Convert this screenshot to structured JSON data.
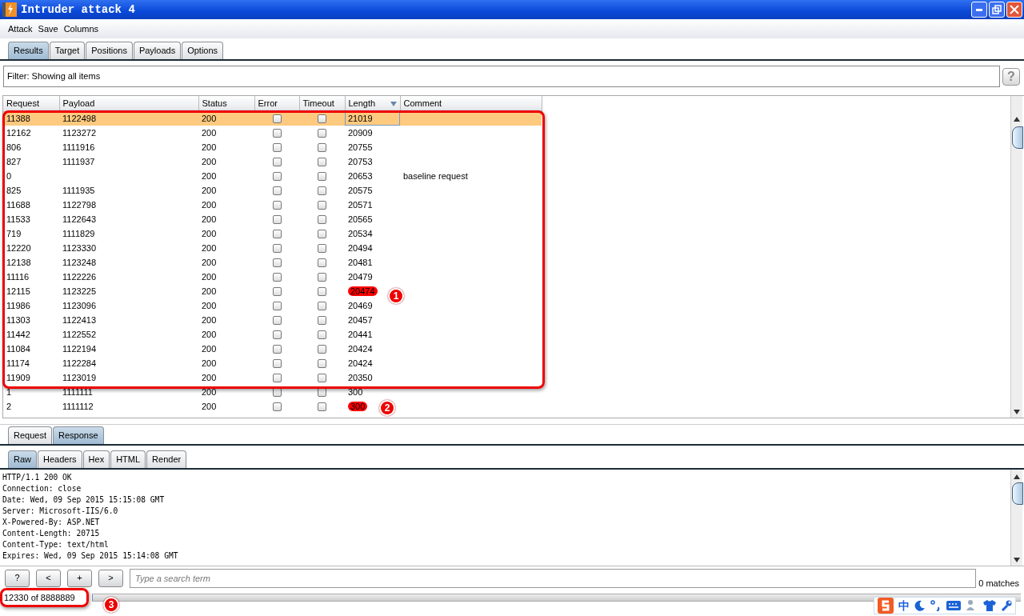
{
  "window": {
    "title": "Intruder attack 4"
  },
  "menu": [
    "Attack",
    "Save",
    "Columns"
  ],
  "tabs": [
    {
      "label": "Results",
      "selected": true
    },
    {
      "label": "Target",
      "selected": false
    },
    {
      "label": "Positions",
      "selected": false
    },
    {
      "label": "Payloads",
      "selected": false
    },
    {
      "label": "Options",
      "selected": false
    }
  ],
  "filter": {
    "text": "Filter:  Showing all items",
    "help": "?"
  },
  "table": {
    "columns": [
      {
        "label": "Request",
        "sorted": false
      },
      {
        "label": "Payload",
        "sorted": false
      },
      {
        "label": "Status",
        "sorted": false
      },
      {
        "label": "Error",
        "sorted": false
      },
      {
        "label": "Timeout",
        "sorted": false
      },
      {
        "label": "Length",
        "sorted": true
      },
      {
        "label": "Comment",
        "sorted": false
      }
    ],
    "rows": [
      {
        "request": "11388",
        "payload": "1122498",
        "status": "200",
        "error": false,
        "timeout": false,
        "length": "21019",
        "comment": "",
        "selected": true,
        "marked": false
      },
      {
        "request": "12162",
        "payload": "1123272",
        "status": "200",
        "error": false,
        "timeout": false,
        "length": "20909",
        "comment": "",
        "selected": false,
        "marked": false
      },
      {
        "request": "806",
        "payload": "1111916",
        "status": "200",
        "error": false,
        "timeout": false,
        "length": "20755",
        "comment": "",
        "selected": false,
        "marked": false
      },
      {
        "request": "827",
        "payload": "1111937",
        "status": "200",
        "error": false,
        "timeout": false,
        "length": "20753",
        "comment": "",
        "selected": false,
        "marked": false
      },
      {
        "request": "0",
        "payload": "",
        "status": "200",
        "error": false,
        "timeout": false,
        "length": "20653",
        "comment": "baseline request",
        "selected": false,
        "marked": false
      },
      {
        "request": "825",
        "payload": "1111935",
        "status": "200",
        "error": false,
        "timeout": false,
        "length": "20575",
        "comment": "",
        "selected": false,
        "marked": false
      },
      {
        "request": "11688",
        "payload": "1122798",
        "status": "200",
        "error": false,
        "timeout": false,
        "length": "20571",
        "comment": "",
        "selected": false,
        "marked": false
      },
      {
        "request": "11533",
        "payload": "1122643",
        "status": "200",
        "error": false,
        "timeout": false,
        "length": "20565",
        "comment": "",
        "selected": false,
        "marked": false
      },
      {
        "request": "719",
        "payload": "1111829",
        "status": "200",
        "error": false,
        "timeout": false,
        "length": "20534",
        "comment": "",
        "selected": false,
        "marked": false
      },
      {
        "request": "12220",
        "payload": "1123330",
        "status": "200",
        "error": false,
        "timeout": false,
        "length": "20494",
        "comment": "",
        "selected": false,
        "marked": false
      },
      {
        "request": "12138",
        "payload": "1123248",
        "status": "200",
        "error": false,
        "timeout": false,
        "length": "20481",
        "comment": "",
        "selected": false,
        "marked": false
      },
      {
        "request": "11116",
        "payload": "1122226",
        "status": "200",
        "error": false,
        "timeout": false,
        "length": "20479",
        "comment": "",
        "selected": false,
        "marked": false
      },
      {
        "request": "12115",
        "payload": "1123225",
        "status": "200",
        "error": false,
        "timeout": false,
        "length": "20474",
        "comment": "",
        "selected": false,
        "marked": true
      },
      {
        "request": "11986",
        "payload": "1123096",
        "status": "200",
        "error": false,
        "timeout": false,
        "length": "20469",
        "comment": "",
        "selected": false,
        "marked": false
      },
      {
        "request": "11303",
        "payload": "1122413",
        "status": "200",
        "error": false,
        "timeout": false,
        "length": "20457",
        "comment": "",
        "selected": false,
        "marked": false
      },
      {
        "request": "11442",
        "payload": "1122552",
        "status": "200",
        "error": false,
        "timeout": false,
        "length": "20441",
        "comment": "",
        "selected": false,
        "marked": false
      },
      {
        "request": "11084",
        "payload": "1122194",
        "status": "200",
        "error": false,
        "timeout": false,
        "length": "20424",
        "comment": "",
        "selected": false,
        "marked": false
      },
      {
        "request": "11174",
        "payload": "1122284",
        "status": "200",
        "error": false,
        "timeout": false,
        "length": "20424",
        "comment": "",
        "selected": false,
        "marked": false
      },
      {
        "request": "11909",
        "payload": "1123019",
        "status": "200",
        "error": false,
        "timeout": false,
        "length": "20350",
        "comment": "",
        "selected": false,
        "marked": false
      },
      {
        "request": "1",
        "payload": "1111111",
        "status": "200",
        "error": false,
        "timeout": false,
        "length": "300",
        "comment": "",
        "selected": false,
        "marked": false
      },
      {
        "request": "2",
        "payload": "1111112",
        "status": "200",
        "error": false,
        "timeout": false,
        "length": "300",
        "comment": "",
        "selected": false,
        "marked": true
      }
    ]
  },
  "message_tabs": [
    {
      "label": "Request",
      "selected": false
    },
    {
      "label": "Response",
      "selected": true
    }
  ],
  "view_tabs": [
    {
      "label": "Raw",
      "selected": true
    },
    {
      "label": "Headers",
      "selected": false
    },
    {
      "label": "Hex",
      "selected": false
    },
    {
      "label": "HTML",
      "selected": false
    },
    {
      "label": "Render",
      "selected": false
    }
  ],
  "response_lines": [
    "HTTP/1.1 200 OK",
    "Connection: close",
    "Date: Wed, 09 Sep 2015 15:15:08 GMT",
    "Server: Microsoft-IIS/6.0",
    "X-Powered-By: ASP.NET",
    "Content-Length: 20715",
    "Content-Type: text/html",
    "Expires: Wed, 09 Sep 2015 15:14:08 GMT"
  ],
  "search": {
    "buttons": [
      "?",
      "<",
      "+",
      ">"
    ],
    "placeholder": "Type a search term",
    "matches": "0 matches"
  },
  "status_bar": {
    "progress": "12330 of 8888889",
    "level": 0.0014
  },
  "ime_bar": {
    "mode": "中"
  },
  "annotations": [
    "1",
    "2",
    "3"
  ]
}
